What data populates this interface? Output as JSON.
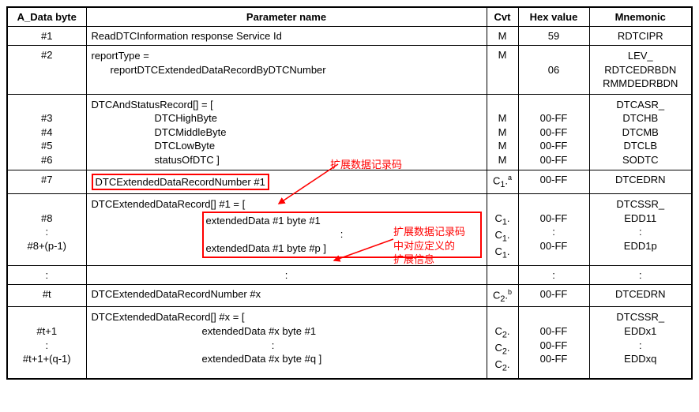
{
  "headers": {
    "adata": "A_Data byte",
    "param": "Parameter name",
    "cvt": "Cvt",
    "hex": "Hex value",
    "mnem": "Mnemonic"
  },
  "rows": {
    "r1": {
      "adata": "#1",
      "param": "ReadDTCInformation response Service Id",
      "cvt": "M",
      "hex": "59",
      "mnem": "RDTCIPR"
    },
    "r2": {
      "adata": "#2",
      "param_l1": "reportType =",
      "param_l2": "reportDTCExtendedDataRecordByDTCNumber",
      "cvt": "M",
      "hex": "06",
      "mnem_l1": "LEV_",
      "mnem_l2": "RDTCEDRBDN",
      "mnem_l3": "RMMDEDRBDN"
    },
    "r3": {
      "adata_l2": "#3",
      "adata_l3": "#4",
      "adata_l4": "#5",
      "adata_l5": "#6",
      "param_l1": "DTCAndStatusRecord[] = [",
      "param_l2": "DTCHighByte",
      "param_l3": "DTCMiddleByte",
      "param_l4": "DTCLowByte",
      "param_l5": "statusOfDTC ]",
      "cvt_l2": "M",
      "cvt_l3": "M",
      "cvt_l4": "M",
      "cvt_l5": "M",
      "hex_l2": "00-FF",
      "hex_l3": "00-FF",
      "hex_l4": "00-FF",
      "hex_l5": "00-FF",
      "mnem_l1": "DTCASR_",
      "mnem_l2": "DTCHB",
      "mnem_l3": "DTCMB",
      "mnem_l4": "DTCLB",
      "mnem_l5": "SODTC"
    },
    "r4": {
      "adata": "#7",
      "param": "DTCExtendedDataRecordNumber #1",
      "cvt": "C₁.ᵃ",
      "hex": "00-FF",
      "mnem": "DTCEDRN"
    },
    "r5": {
      "adata_l2": "#8",
      "adata_l3": ":",
      "adata_l4": "#8+(p-1)",
      "param_l1": "DTCExtendedDataRecord[] #1 = [",
      "param_l2": "extendedData #1 byte #1",
      "param_l3": ":",
      "param_l4": "extendedData #1 byte #p ]",
      "cvt_l2": "C₁.",
      "cvt_l3": "C₁.",
      "cvt_l4": "C₁.",
      "hex_l2": "00-FF",
      "hex_l3": ":",
      "hex_l4": "00-FF",
      "mnem_l1": "DTCSSR_",
      "mnem_l2": "EDD11",
      "mnem_l3": ":",
      "mnem_l4": "EDD1p"
    },
    "r6": {
      "adata": ":",
      "param": ":",
      "hex": ":",
      "mnem": ":"
    },
    "r7": {
      "adata": "#t",
      "param": "DTCExtendedDataRecordNumber #x",
      "cvt": "C₂.ᵇ",
      "hex": "00-FF",
      "mnem": "DTCEDRN"
    },
    "r8": {
      "adata_l2": "#t+1",
      "adata_l3": ":",
      "adata_l4": "#t+1+(q-1)",
      "param_l1": "DTCExtendedDataRecord[] #x = [",
      "param_l2": "extendedData #x byte #1",
      "param_l3": ":",
      "param_l4": "extendedData #x byte #q ]",
      "cvt_l2": "C₂.",
      "cvt_l3": "C₂.",
      "cvt_l4": "C₂.",
      "hex_l2": "00-FF",
      "hex_l3": "00-FF",
      "hex_l4": "00-FF",
      "mnem_l1": "DTCSSR_",
      "mnem_l2": "EDDx1",
      "mnem_l3": ":",
      "mnem_l4": "EDDxq"
    }
  },
  "annotations": {
    "a1": "扩展数据记录码",
    "a2_l1": "扩展数据记录码",
    "a2_l2": "中对应定义的",
    "a2_l3": "扩展信息"
  },
  "watermark": ""
}
